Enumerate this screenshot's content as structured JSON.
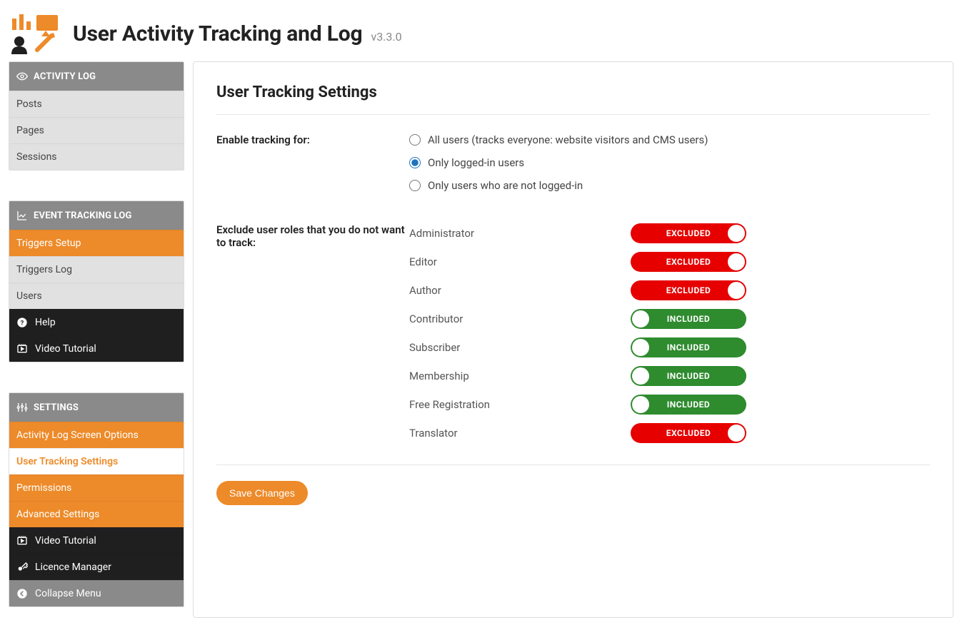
{
  "header": {
    "title": "User Activity Tracking and Log",
    "version": "v3.3.0"
  },
  "sidebar": {
    "sections": [
      {
        "title": "ACTIVITY LOG",
        "items": [
          {
            "label": "Posts",
            "style": "light"
          },
          {
            "label": "Pages",
            "style": "light"
          },
          {
            "label": "Sessions",
            "style": "light"
          }
        ]
      },
      {
        "title": "EVENT TRACKING LOG",
        "items": [
          {
            "label": "Triggers Setup",
            "style": "orange"
          },
          {
            "label": "Triggers Log",
            "style": "light"
          },
          {
            "label": "Users",
            "style": "light"
          },
          {
            "label": "Help",
            "style": "black",
            "icon": "help"
          },
          {
            "label": "Video Tutorial",
            "style": "black",
            "icon": "video"
          }
        ]
      },
      {
        "title": "SETTINGS",
        "items": [
          {
            "label": "Activity Log Screen Options",
            "style": "orange"
          },
          {
            "label": "User Tracking Settings",
            "style": "orange",
            "selected": true
          },
          {
            "label": "Permissions",
            "style": "orange"
          },
          {
            "label": "Advanced Settings",
            "style": "orange"
          },
          {
            "label": "Video Tutorial",
            "style": "black",
            "icon": "video"
          },
          {
            "label": "Licence Manager",
            "style": "black",
            "icon": "key"
          },
          {
            "label": "Collapse Menu",
            "style": "grey",
            "icon": "collapse"
          }
        ]
      }
    ]
  },
  "main": {
    "heading": "User Tracking Settings",
    "enable_label": "Enable tracking for:",
    "enable_options": [
      {
        "label": "All users (tracks everyone: website visitors and CMS users)",
        "checked": false
      },
      {
        "label": "Only logged-in users",
        "checked": true
      },
      {
        "label": "Only users who are not logged-in",
        "checked": false
      }
    ],
    "exclude_label": "Exclude user roles that you do not want to track:",
    "roles": [
      {
        "name": "Administrator",
        "state": "excluded"
      },
      {
        "name": "Editor",
        "state": "excluded"
      },
      {
        "name": "Author",
        "state": "excluded"
      },
      {
        "name": "Contributor",
        "state": "included"
      },
      {
        "name": "Subscriber",
        "state": "included"
      },
      {
        "name": "Membership",
        "state": "included"
      },
      {
        "name": "Free Registration",
        "state": "included"
      },
      {
        "name": "Translator",
        "state": "excluded"
      }
    ],
    "toggle_labels": {
      "excluded": "EXCLUDED",
      "included": "INCLUDED"
    },
    "save_label": "Save Changes"
  }
}
